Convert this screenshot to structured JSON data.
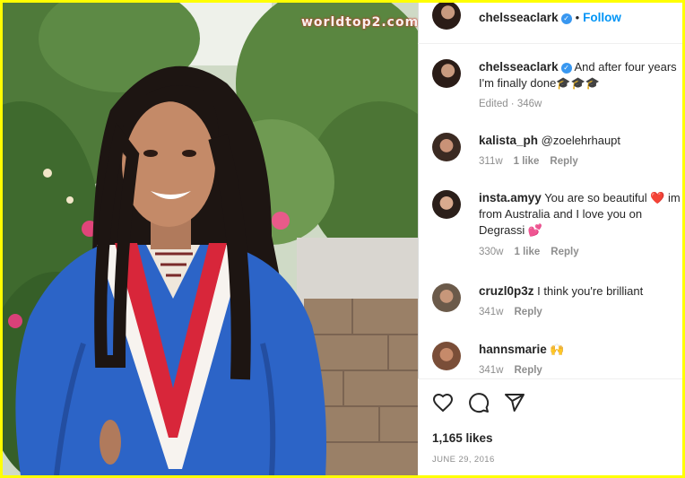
{
  "watermark": "worldtop2.com",
  "header": {
    "username": "chelsseaclark",
    "separator": "•",
    "follow_label": "Follow"
  },
  "caption": {
    "username": "chelsseaclark",
    "text": "And after four years I'm finally done🎓🎓🎓",
    "meta": "Edited · 346w"
  },
  "comments": [
    {
      "username": "kalista_ph",
      "text": "@zoelehrhaupt",
      "age": "311w",
      "likes": "1 like",
      "reply": "Reply"
    },
    {
      "username": "insta.amyy",
      "text": "You are so beautiful ❤️ im from Australia and I love you on Degrassi 💕",
      "age": "330w",
      "likes": "1 like",
      "reply": "Reply"
    },
    {
      "username": "cruzl0p3z",
      "text": "I think you're brilliant",
      "age": "341w",
      "likes": "",
      "reply": "Reply"
    },
    {
      "username": "hannsmarie",
      "text": "🙌",
      "age": "341w",
      "likes": "",
      "reply": "Reply"
    }
  ],
  "actions": {
    "icons": [
      "heart-icon",
      "comment-icon",
      "share-icon"
    ],
    "likes": "1,165 likes",
    "date": "JUNE 29, 2016"
  },
  "colors": {
    "border": "#ffff00",
    "accent": "#0095f6",
    "verified": "#3897f0",
    "muted": "#8e8e8e"
  }
}
